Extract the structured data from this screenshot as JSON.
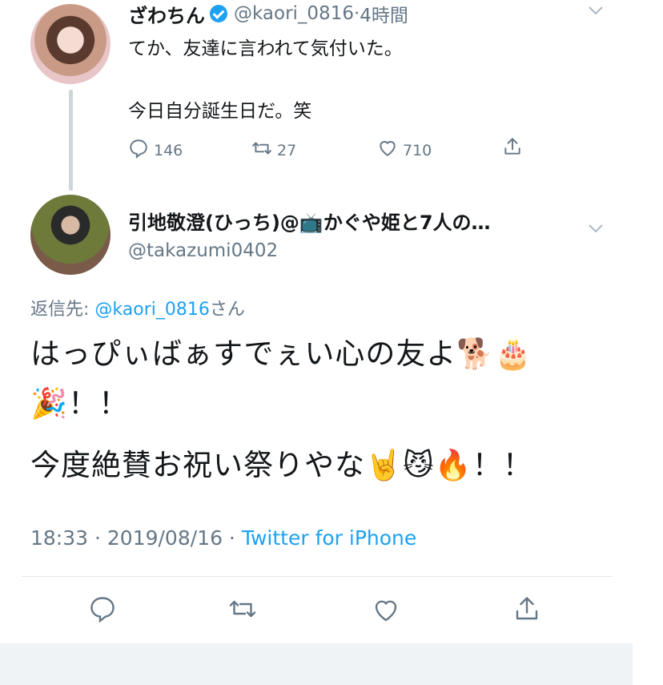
{
  "tweet1": {
    "display_name": "ざわちん",
    "handle": "@kaori_0816",
    "time_ago": "4時間",
    "line1": "てか、友達に言われて気付いた。",
    "line2": "今日自分誕生日だ。笑",
    "reply_count": "146",
    "retweet_count": "27",
    "like_count": "710"
  },
  "tweet2": {
    "display_name": "引地敬澄(ひっち)@📺かぐや姫と7人の…",
    "handle": "@takazumi0402",
    "reply_prefix": "返信先: ",
    "reply_to": "@kaori_0816",
    "reply_suffix": "さん",
    "text_line1": "はっぴぃばぁすでぇい心の友よ🐕🎂",
    "text_line2": "🎉！！",
    "text_line3": "今度絶賛お祝い祭りやな🤘😼🔥！！",
    "timestamp": "18:33 · 2019/08/16 · ",
    "source": "Twitter for iPhone"
  },
  "icons": [
    "verified-badge-icon",
    "chevron-down-icon",
    "reply-icon",
    "retweet-icon",
    "like-icon",
    "share-icon"
  ],
  "colors": {
    "link": "#1da1f2",
    "secondary_text": "#657786",
    "primary_text": "#14171a",
    "thread_line": "#ccd6dd"
  }
}
